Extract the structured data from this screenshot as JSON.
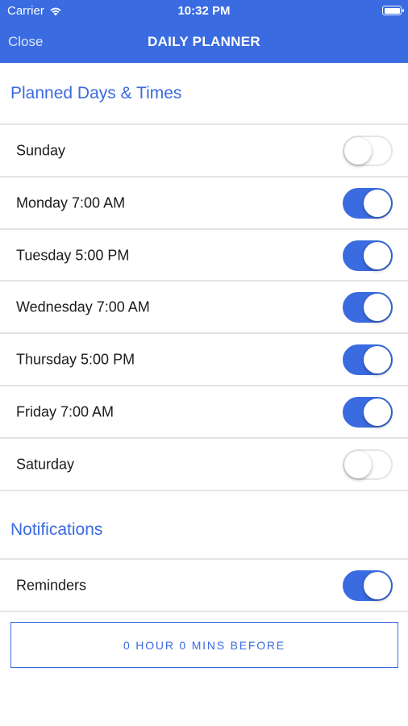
{
  "status_bar": {
    "carrier": "Carrier",
    "time": "10:32 PM"
  },
  "nav": {
    "close_label": "Close",
    "title": "DAILY PLANNER"
  },
  "planned": {
    "header": "Planned Days & Times",
    "days": [
      {
        "label": "Sunday",
        "enabled": false
      },
      {
        "label": "Monday 7:00 AM",
        "enabled": true
      },
      {
        "label": "Tuesday 5:00 PM",
        "enabled": true
      },
      {
        "label": "Wednesday 7:00 AM",
        "enabled": true
      },
      {
        "label": "Thursday 5:00 PM",
        "enabled": true
      },
      {
        "label": "Friday 7:00 AM",
        "enabled": true
      },
      {
        "label": "Saturday",
        "enabled": false
      }
    ]
  },
  "notifications": {
    "header": "Notifications",
    "reminders_label": "Reminders",
    "reminders_enabled": true,
    "reminder_time_label": "0 HOUR 0 MINS BEFORE"
  },
  "colors": {
    "accent": "#3a6be0",
    "toggle_off_border": "#e5e5e5",
    "divider": "#e4e4e4"
  },
  "icons": {
    "wifi": "wifi-icon",
    "battery": "battery-icon"
  }
}
